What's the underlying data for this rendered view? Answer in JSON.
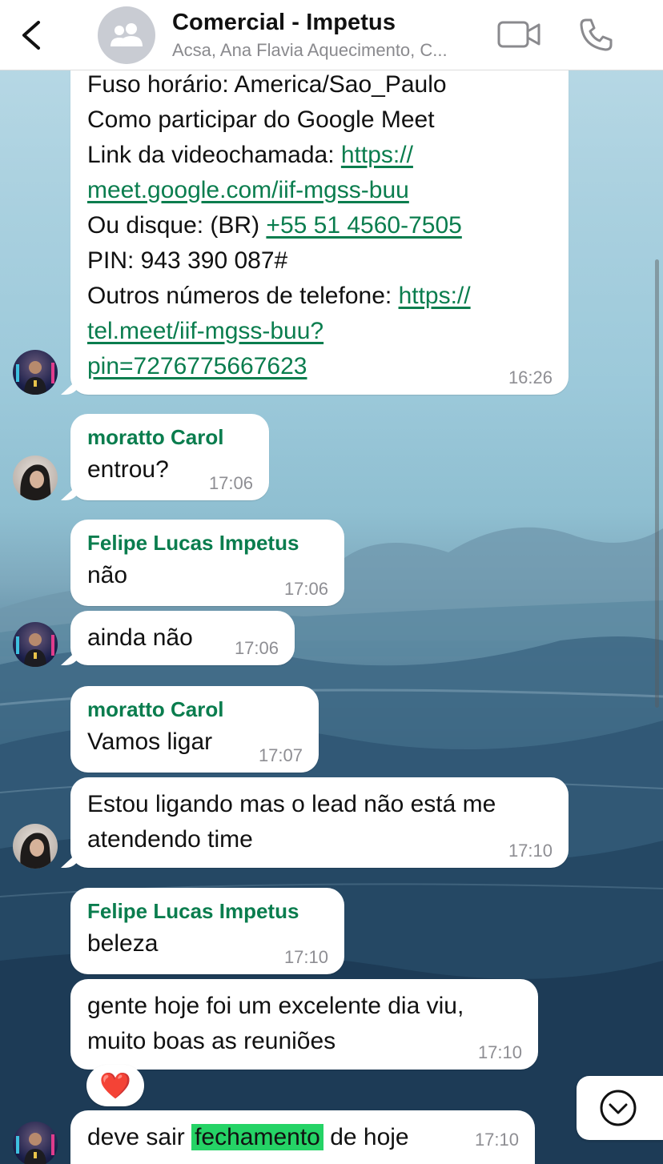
{
  "header": {
    "title": "Comercial - Impetus",
    "subtitle": "Acsa, Ana Flavia Aquecimento, C..."
  },
  "messages": [
    {
      "sender": "",
      "lines": [
        "Fuso horário: America/Sao_Paulo",
        "Como participar do Google Meet"
      ],
      "link_label": "Link da videochamada: ",
      "link_part1": "https://",
      "link_part2": "meet.google.com/iif-mgss-buu",
      "dial_label": "Ou disque: (BR) ",
      "dial_number": "+55 51 4560-7505",
      "pin": "PIN: 943 390 087#",
      "other_label": "Outros números de telefone: ",
      "other_link1": "https://",
      "other_link2": "tel.meet/iif-mgss-buu?",
      "other_link3": "pin=7276775667623",
      "time": "16:26"
    },
    {
      "sender": "moratto Carol",
      "text": "entrou?",
      "time": "17:06"
    },
    {
      "sender": "Felipe Lucas Impetus",
      "text": "não",
      "time": "17:06"
    },
    {
      "sender": "",
      "text": "ainda não",
      "time": "17:06"
    },
    {
      "sender": "moratto Carol",
      "text": "Vamos ligar",
      "time": "17:07"
    },
    {
      "sender": "",
      "text_line1": "Estou ligando mas o lead não está me",
      "text_line2": "atendendo time",
      "time": "17:10"
    },
    {
      "sender": "Felipe Lucas Impetus",
      "text": "beleza",
      "time": "17:10"
    },
    {
      "sender": "",
      "text_line1": "gente hoje foi um excelente dia viu,",
      "text_line2": "muito boas as reuniões",
      "time": "17:10",
      "reaction": "❤️"
    },
    {
      "sender": "",
      "text_before": "deve sair ",
      "highlight": "fechamento",
      "text_after": " de hoje",
      "time": "17:10"
    }
  ],
  "icons": {
    "back": "chevron-left-icon",
    "group": "group-people-icon",
    "video": "video-camera-icon",
    "call": "phone-icon",
    "scroll": "chevron-down-circle-icon"
  },
  "colors": {
    "accent": "#0a7d4e",
    "highlight": "#25d366",
    "bubble": "#ffffff"
  }
}
